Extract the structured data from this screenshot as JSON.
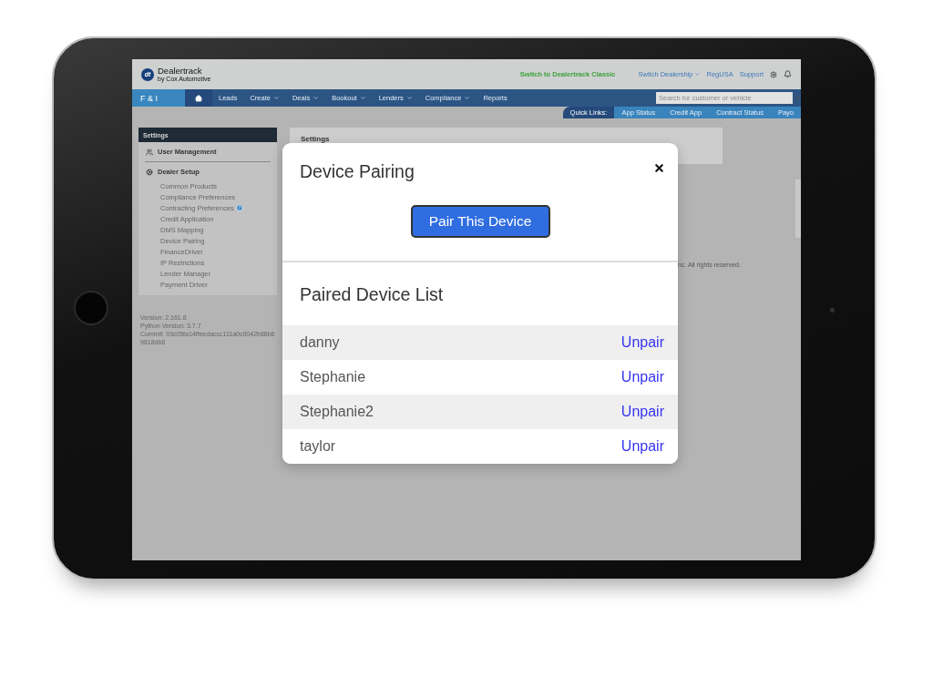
{
  "header": {
    "logo_mark": "dt",
    "brand": "Dealertrack",
    "brand_sub": "by Cox Automotive",
    "links": [
      {
        "label": "Switch to Dealertrack Classic",
        "kind": "highlight"
      },
      {
        "label": "Switch Dealership",
        "kind": "dropdown"
      },
      {
        "label": "RegUSA",
        "kind": "plain"
      },
      {
        "label": "Support",
        "kind": "plain"
      }
    ]
  },
  "nav": {
    "section": "F & I",
    "items": [
      {
        "label": "Leads",
        "dropdown": false
      },
      {
        "label": "Create",
        "dropdown": true
      },
      {
        "label": "Deals",
        "dropdown": true
      },
      {
        "label": "Bookout",
        "dropdown": true
      },
      {
        "label": "Lenders",
        "dropdown": true
      },
      {
        "label": "Compliance",
        "dropdown": true
      },
      {
        "label": "Reports",
        "dropdown": false
      }
    ],
    "search": {
      "placeholder": "Search for customer or vehicle"
    }
  },
  "quick_links": {
    "label": "Quick Links:",
    "items": [
      "App Status",
      "Credit App",
      "Contract Status",
      "Payo"
    ]
  },
  "sidebar": {
    "title": "Settings",
    "groups": [
      {
        "label": "User Management"
      },
      {
        "label": "Dealer Setup",
        "items": [
          {
            "label": "Common Products",
            "help": false
          },
          {
            "label": "Compliance Preferences",
            "help": false
          },
          {
            "label": "Contracting Preferences",
            "help": true
          },
          {
            "label": "Credit Application",
            "help": false
          },
          {
            "label": "DMS Mapping",
            "help": false
          },
          {
            "label": "Device Pairing",
            "help": false
          },
          {
            "label": "FinanceDriver",
            "help": false
          },
          {
            "label": "IP Restrictions",
            "help": false
          },
          {
            "label": "Lender Manager",
            "help": false
          },
          {
            "label": "Payment Driver",
            "help": false
          }
        ]
      }
    ]
  },
  "version_info": [
    "Version: 2.161.8",
    "Python Version: 3.7.7",
    "Commit: 93c05fa14ffeedaccc111a0c0042b88b69818db8"
  ],
  "content": {
    "title": "Settings",
    "footer": "nc. All rights reserved."
  },
  "modal": {
    "title": "Device Pairing",
    "action": "Pair This Device",
    "list_title": "Paired Device List",
    "devices": [
      {
        "name": "danny",
        "action": "Unpair"
      },
      {
        "name": "Stephanie",
        "action": "Unpair"
      },
      {
        "name": "Stephanie2",
        "action": "Unpair"
      },
      {
        "name": "taylor",
        "action": "Unpair"
      }
    ]
  }
}
